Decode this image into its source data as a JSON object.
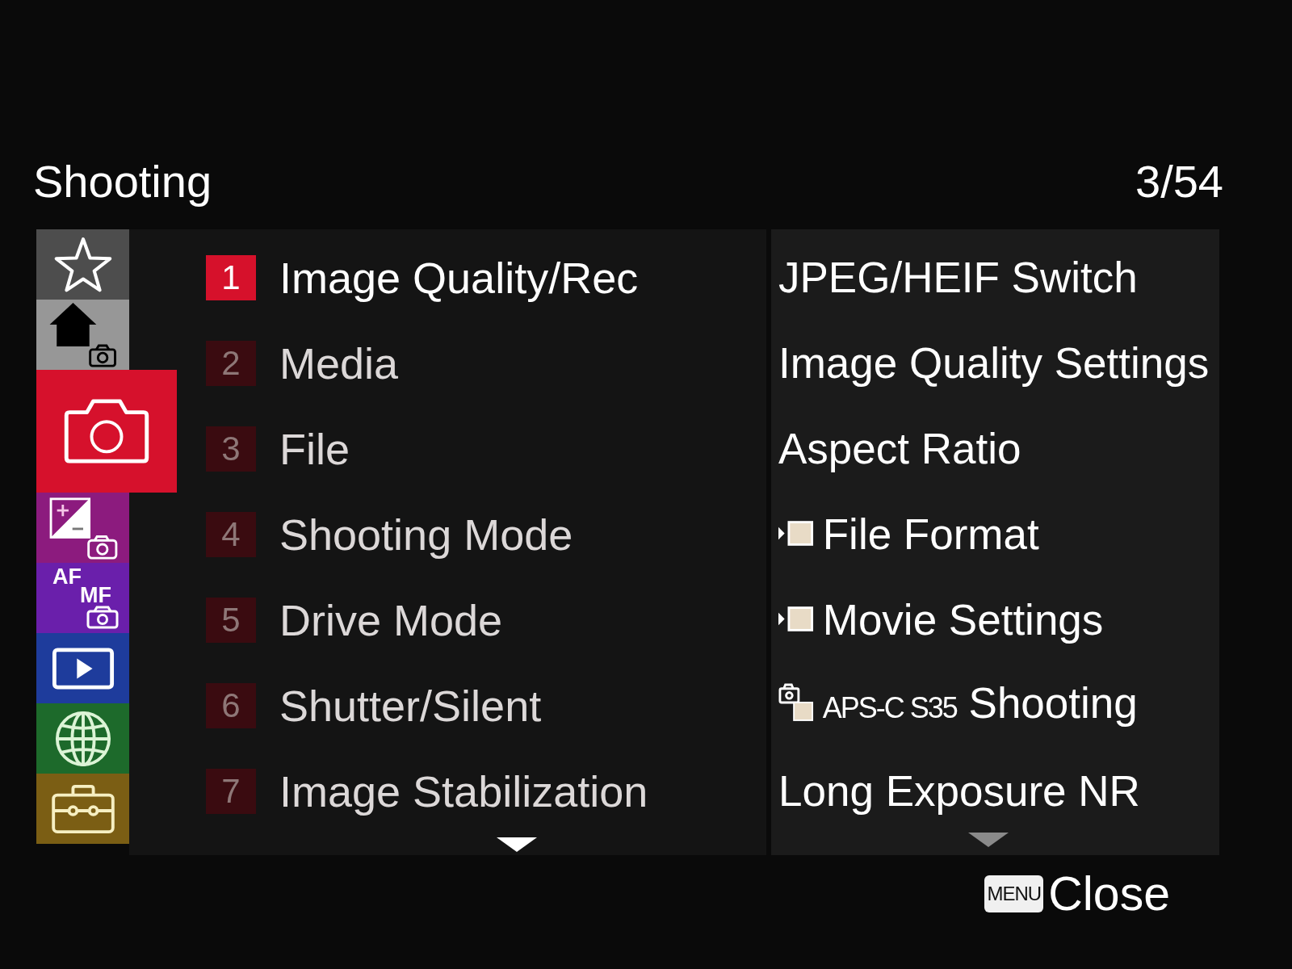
{
  "header": {
    "title": "Shooting",
    "page": "3/54"
  },
  "sidebar": {
    "tabs": [
      {
        "kind": "star",
        "color": "#4d4d4d",
        "selected": false
      },
      {
        "kind": "home-camera",
        "color": "#979797",
        "selected": false
      },
      {
        "kind": "camera",
        "color": "#d6112c",
        "selected": true
      },
      {
        "kind": "exposure",
        "color": "#8c1b7e",
        "selected": false
      },
      {
        "kind": "af-mf",
        "color": "#6a1fab",
        "selected": false,
        "labels": [
          "AF",
          "MF"
        ]
      },
      {
        "kind": "playback",
        "color": "#1e3c9c",
        "selected": false
      },
      {
        "kind": "network",
        "color": "#1d6a2b",
        "selected": false
      },
      {
        "kind": "setup",
        "color": "#7b5e14",
        "selected": false
      }
    ]
  },
  "groups": [
    {
      "number": "1",
      "label": "Image Quality/Rec",
      "selected": true
    },
    {
      "number": "2",
      "label": "Media",
      "selected": false
    },
    {
      "number": "3",
      "label": "File",
      "selected": false
    },
    {
      "number": "4",
      "label": "Shooting Mode",
      "selected": false
    },
    {
      "number": "5",
      "label": "Drive Mode",
      "selected": false
    },
    {
      "number": "6",
      "label": "Shutter/Silent",
      "selected": false
    },
    {
      "number": "7",
      "label": "Image Stabilization",
      "selected": false
    }
  ],
  "settings": [
    {
      "kind": "text",
      "label": "JPEG/HEIF Switch"
    },
    {
      "kind": "text",
      "label": "Image Quality Settings"
    },
    {
      "kind": "text",
      "label": "Aspect Ratio"
    },
    {
      "kind": "movie",
      "label": "File Format"
    },
    {
      "kind": "movie",
      "label": "Movie Settings"
    },
    {
      "kind": "crop",
      "prefix": "APS-C S35",
      "label": "Shooting"
    },
    {
      "kind": "text",
      "label": "Long Exposure NR"
    }
  ],
  "footer": {
    "key": "MENU",
    "label": "Close"
  }
}
